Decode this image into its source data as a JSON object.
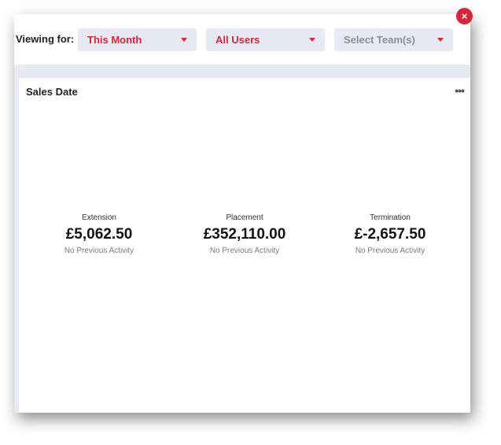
{
  "filters": {
    "viewing_label": "Viewing for:",
    "period": "This Month",
    "users": "All Users",
    "team_placeholder": "Select Team(s)"
  },
  "close_icon": "×",
  "card": {
    "title": "Sales Date",
    "more_icon": "•••",
    "stats": [
      {
        "label": "Extension",
        "value": "£5,062.50",
        "sub": "No Previous Activity"
      },
      {
        "label": "Placement",
        "value": "£352,110.00",
        "sub": "No Previous Activity"
      },
      {
        "label": "Termination",
        "value": "£-2,657.50",
        "sub": "No Previous Activity"
      }
    ]
  },
  "colors": {
    "accent": "#d6263b",
    "dropdown_bg": "#e7eaf2",
    "placeholder": "#8a8f9a"
  }
}
